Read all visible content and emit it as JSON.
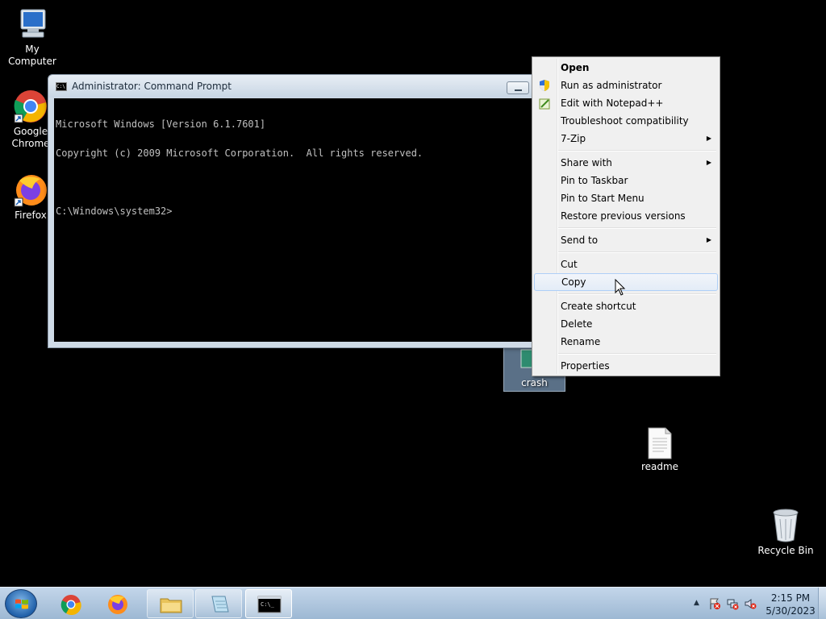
{
  "desktop": {
    "icons": {
      "my_computer": "My Computer",
      "chrome": "Google Chrome",
      "firefox": "Firefox",
      "crash": "crash",
      "readme": "readme",
      "recycle": "Recycle Bin"
    }
  },
  "cmd_window": {
    "title": "Administrator:  Command Prompt",
    "lines": [
      "Microsoft Windows [Version 6.1.7601]",
      "Copyright (c) 2009 Microsoft Corporation.  All rights reserved.",
      "",
      "C:\\Windows\\system32>"
    ]
  },
  "context_menu": {
    "items": [
      {
        "label": "Open",
        "bold": true
      },
      {
        "label": "Run as administrator",
        "icon": "uac-shield-icon"
      },
      {
        "label": "Edit with Notepad++",
        "icon": "notepadpp-icon"
      },
      {
        "label": "Troubleshoot compatibility"
      },
      {
        "label": "7-Zip",
        "submenu": true
      },
      {
        "label": "Share with",
        "submenu": true
      },
      {
        "label": "Pin to Taskbar"
      },
      {
        "label": "Pin to Start Menu"
      },
      {
        "label": "Restore previous versions"
      },
      {
        "label": "Send to",
        "submenu": true
      },
      {
        "label": "Cut"
      },
      {
        "label": "Copy",
        "highlighted": true
      },
      {
        "label": "Create shortcut"
      },
      {
        "label": "Delete"
      },
      {
        "label": "Rename"
      },
      {
        "label": "Properties"
      }
    ]
  },
  "taskbar": {
    "clock_time": "2:15 PM",
    "clock_date": "5/30/2023",
    "buttons": [
      "start-button",
      "chrome-icon",
      "firefox-icon",
      "explorer-icon",
      "notepad-icon",
      "cmd-icon"
    ]
  }
}
